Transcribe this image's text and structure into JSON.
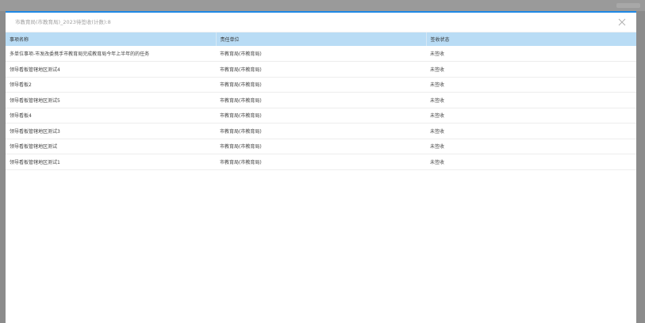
{
  "modal": {
    "title": "市教育局(市教育局)_2023待签收(计数):8",
    "close_icon": "close-icon"
  },
  "table": {
    "headers": [
      "事项名称",
      "责任单位",
      "签收状态"
    ],
    "rows": [
      [
        "多单位事项-市发改委携手市教育局完成教育局今年上半年的的任务",
        "市教育局(市教育局)",
        "未签收"
      ],
      [
        "领导看板管辖地区测试4",
        "市教育局(市教育局)",
        "未签收"
      ],
      [
        "领导看板2",
        "市教育局(市教育局)",
        "未签收"
      ],
      [
        "领导看板管辖地区测试5",
        "市教育局(市教育局)",
        "未签收"
      ],
      [
        "领导看板4",
        "市教育局(市教育局)",
        "未签收"
      ],
      [
        "领导看板管辖地区测试3",
        "市教育局(市教育局)",
        "未签收"
      ],
      [
        "领导看板管辖地区测试",
        "市教育局(市教育局)",
        "未签收"
      ],
      [
        "领导看板管辖地区测试1",
        "市教育局(市教育局)",
        "未签收"
      ]
    ]
  }
}
